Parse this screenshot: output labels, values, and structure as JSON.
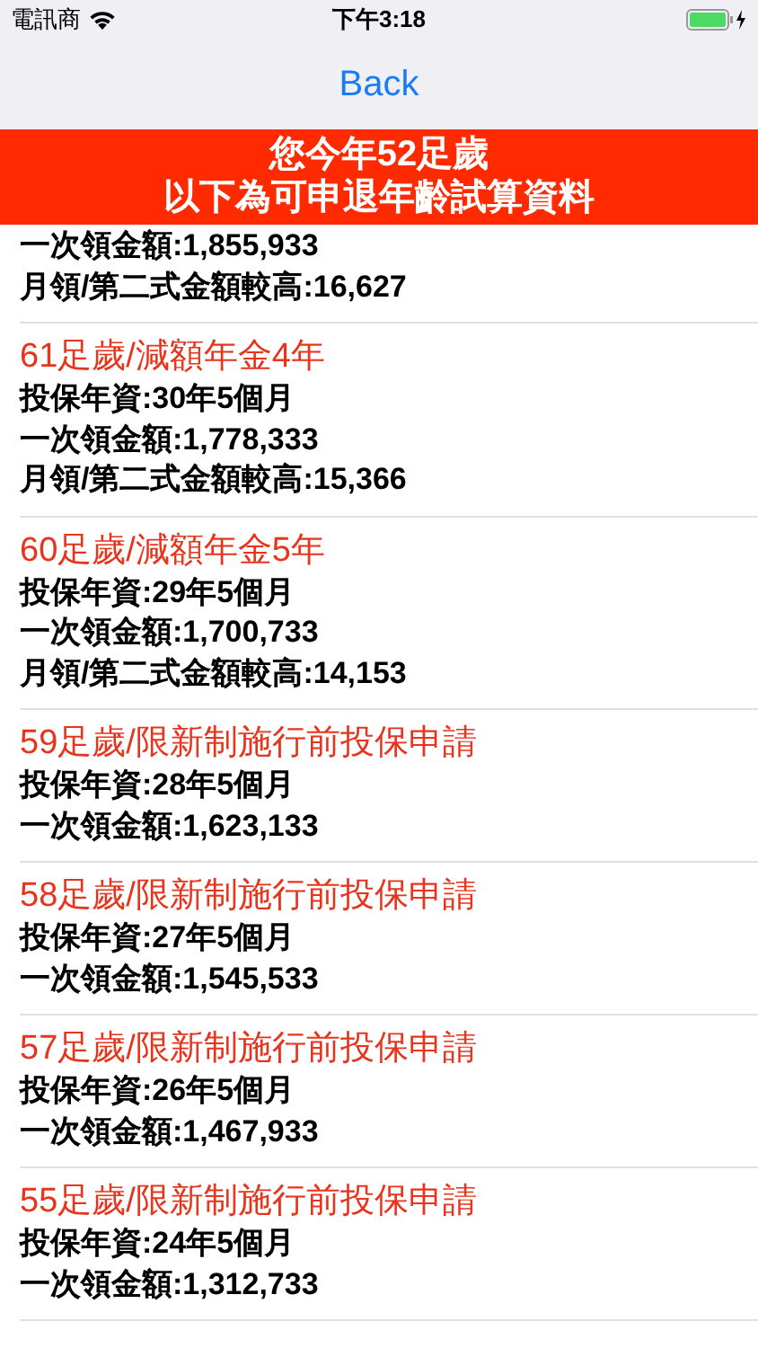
{
  "status_bar": {
    "carrier": "電訊商",
    "time": "下午3:18"
  },
  "nav_bar": {
    "back": "Back"
  },
  "banner": {
    "lines": [
      "您今年**52**足歲",
      "以下為可申退年齡試算資料"
    ]
  },
  "items": [
    {
      "lines": [
        "一次領金額:1,855,933",
        "月領/第二式金額較高:16,627"
      ]
    },
    {
      "title": "61足歲/減額年金4年",
      "lines": [
        "投保年資:30年5個月",
        "一次領金額:1,778,333",
        "月領/第二式金額較高:15,366"
      ]
    },
    {
      "title": "60足歲/減額年金5年",
      "lines": [
        "投保年資:29年5個月",
        "一次領金額:1,700,733",
        "月領/第二式金額較高:14,153"
      ]
    },
    {
      "title": "59足歲/限新制施行前投保申請",
      "lines": [
        "投保年資:28年5個月",
        "一次領金額:1,623,133"
      ]
    },
    {
      "title": "58足歲/限新制施行前投保申請",
      "lines": [
        "投保年資:27年5個月",
        "一次領金額:1,545,533"
      ]
    },
    {
      "title": "57足歲/限新制施行前投保申請",
      "lines": [
        "投保年資:26年5個月",
        "一次領金額:1,467,933"
      ]
    },
    {
      "title": "55足歲/限新制施行前投保申請",
      "lines": [
        "投保年資:24年5個月",
        "一次領金額:1,312,733"
      ]
    }
  ]
}
